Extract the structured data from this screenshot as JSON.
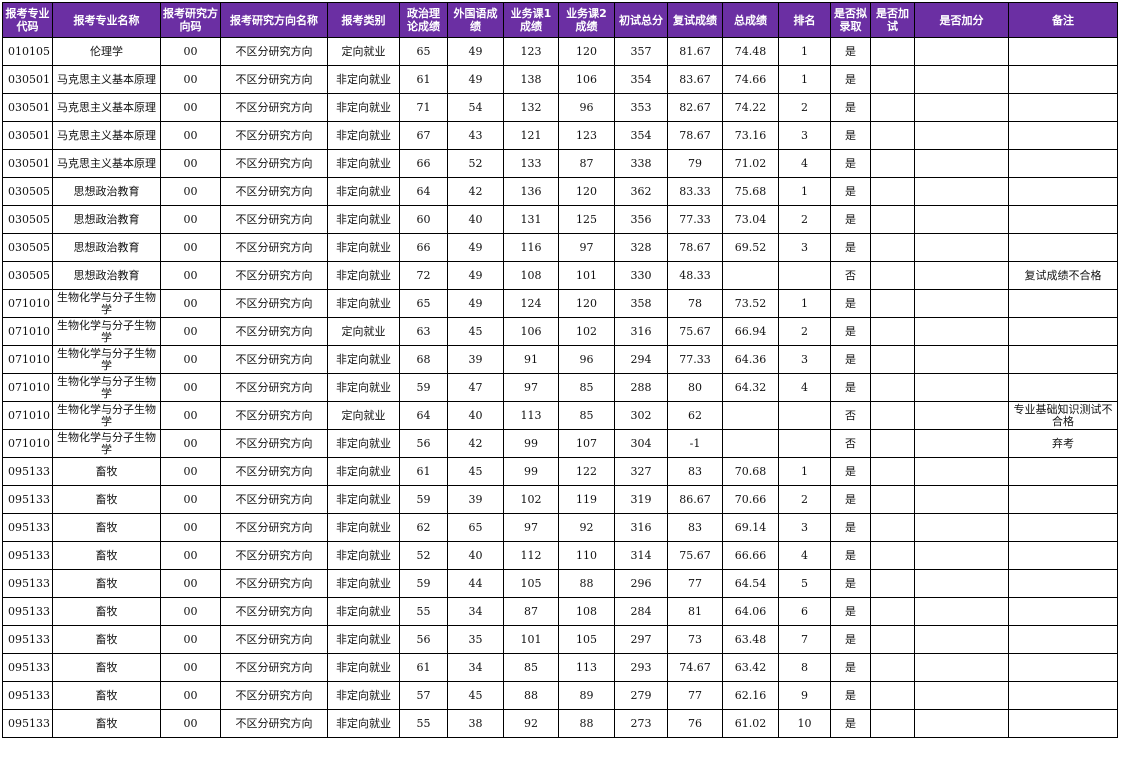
{
  "headers": [
    "报考专业代码",
    "报考专业名称",
    "报考研究方向码",
    "报考研究方向名称",
    "报考类别",
    "政治理论成绩",
    "外国语成绩",
    "业务课1成绩",
    "业务课2成绩",
    "初试总分",
    "复试成绩",
    "总成绩",
    "排名",
    "是否拟录取",
    "是否加试",
    "是否加分",
    "备注"
  ],
  "rows": [
    [
      "010105",
      "伦理学",
      "00",
      "不区分研究方向",
      "定向就业",
      "65",
      "49",
      "123",
      "120",
      "357",
      "81.67",
      "74.48",
      "1",
      "是",
      "",
      "",
      ""
    ],
    [
      "030501",
      "马克思主义基本原理",
      "00",
      "不区分研究方向",
      "非定向就业",
      "61",
      "49",
      "138",
      "106",
      "354",
      "83.67",
      "74.66",
      "1",
      "是",
      "",
      "",
      ""
    ],
    [
      "030501",
      "马克思主义基本原理",
      "00",
      "不区分研究方向",
      "非定向就业",
      "71",
      "54",
      "132",
      "96",
      "353",
      "82.67",
      "74.22",
      "2",
      "是",
      "",
      "",
      ""
    ],
    [
      "030501",
      "马克思主义基本原理",
      "00",
      "不区分研究方向",
      "非定向就业",
      "67",
      "43",
      "121",
      "123",
      "354",
      "78.67",
      "73.16",
      "3",
      "是",
      "",
      "",
      ""
    ],
    [
      "030501",
      "马克思主义基本原理",
      "00",
      "不区分研究方向",
      "非定向就业",
      "66",
      "52",
      "133",
      "87",
      "338",
      "79",
      "71.02",
      "4",
      "是",
      "",
      "",
      ""
    ],
    [
      "030505",
      "思想政治教育",
      "00",
      "不区分研究方向",
      "非定向就业",
      "64",
      "42",
      "136",
      "120",
      "362",
      "83.33",
      "75.68",
      "1",
      "是",
      "",
      "",
      ""
    ],
    [
      "030505",
      "思想政治教育",
      "00",
      "不区分研究方向",
      "非定向就业",
      "60",
      "40",
      "131",
      "125",
      "356",
      "77.33",
      "73.04",
      "2",
      "是",
      "",
      "",
      ""
    ],
    [
      "030505",
      "思想政治教育",
      "00",
      "不区分研究方向",
      "非定向就业",
      "66",
      "49",
      "116",
      "97",
      "328",
      "78.67",
      "69.52",
      "3",
      "是",
      "",
      "",
      ""
    ],
    [
      "030505",
      "思想政治教育",
      "00",
      "不区分研究方向",
      "非定向就业",
      "72",
      "49",
      "108",
      "101",
      "330",
      "48.33",
      "",
      "",
      "否",
      "",
      "",
      "复试成绩不合格"
    ],
    [
      "071010",
      "生物化学与分子生物学",
      "00",
      "不区分研究方向",
      "非定向就业",
      "65",
      "49",
      "124",
      "120",
      "358",
      "78",
      "73.52",
      "1",
      "是",
      "",
      "",
      ""
    ],
    [
      "071010",
      "生物化学与分子生物学",
      "00",
      "不区分研究方向",
      "定向就业",
      "63",
      "45",
      "106",
      "102",
      "316",
      "75.67",
      "66.94",
      "2",
      "是",
      "",
      "",
      ""
    ],
    [
      "071010",
      "生物化学与分子生物学",
      "00",
      "不区分研究方向",
      "非定向就业",
      "68",
      "39",
      "91",
      "96",
      "294",
      "77.33",
      "64.36",
      "3",
      "是",
      "",
      "",
      ""
    ],
    [
      "071010",
      "生物化学与分子生物学",
      "00",
      "不区分研究方向",
      "非定向就业",
      "59",
      "47",
      "97",
      "85",
      "288",
      "80",
      "64.32",
      "4",
      "是",
      "",
      "",
      ""
    ],
    [
      "071010",
      "生物化学与分子生物学",
      "00",
      "不区分研究方向",
      "定向就业",
      "64",
      "40",
      "113",
      "85",
      "302",
      "62",
      "",
      "",
      "否",
      "",
      "",
      "专业基础知识测试不合格"
    ],
    [
      "071010",
      "生物化学与分子生物学",
      "00",
      "不区分研究方向",
      "非定向就业",
      "56",
      "42",
      "99",
      "107",
      "304",
      "-1",
      "",
      "",
      "否",
      "",
      "",
      "弃考"
    ],
    [
      "095133",
      "畜牧",
      "00",
      "不区分研究方向",
      "非定向就业",
      "61",
      "45",
      "99",
      "122",
      "327",
      "83",
      "70.68",
      "1",
      "是",
      "",
      "",
      ""
    ],
    [
      "095133",
      "畜牧",
      "00",
      "不区分研究方向",
      "非定向就业",
      "59",
      "39",
      "102",
      "119",
      "319",
      "86.67",
      "70.66",
      "2",
      "是",
      "",
      "",
      ""
    ],
    [
      "095133",
      "畜牧",
      "00",
      "不区分研究方向",
      "非定向就业",
      "62",
      "65",
      "97",
      "92",
      "316",
      "83",
      "69.14",
      "3",
      "是",
      "",
      "",
      ""
    ],
    [
      "095133",
      "畜牧",
      "00",
      "不区分研究方向",
      "非定向就业",
      "52",
      "40",
      "112",
      "110",
      "314",
      "75.67",
      "66.66",
      "4",
      "是",
      "",
      "",
      ""
    ],
    [
      "095133",
      "畜牧",
      "00",
      "不区分研究方向",
      "非定向就业",
      "59",
      "44",
      "105",
      "88",
      "296",
      "77",
      "64.54",
      "5",
      "是",
      "",
      "",
      ""
    ],
    [
      "095133",
      "畜牧",
      "00",
      "不区分研究方向",
      "非定向就业",
      "55",
      "34",
      "87",
      "108",
      "284",
      "81",
      "64.06",
      "6",
      "是",
      "",
      "",
      ""
    ],
    [
      "095133",
      "畜牧",
      "00",
      "不区分研究方向",
      "非定向就业",
      "56",
      "35",
      "101",
      "105",
      "297",
      "73",
      "63.48",
      "7",
      "是",
      "",
      "",
      ""
    ],
    [
      "095133",
      "畜牧",
      "00",
      "不区分研究方向",
      "非定向就业",
      "61",
      "34",
      "85",
      "113",
      "293",
      "74.67",
      "63.42",
      "8",
      "是",
      "",
      "",
      ""
    ],
    [
      "095133",
      "畜牧",
      "00",
      "不区分研究方向",
      "非定向就业",
      "57",
      "45",
      "88",
      "89",
      "279",
      "77",
      "62.16",
      "9",
      "是",
      "",
      "",
      ""
    ],
    [
      "095133",
      "畜牧",
      "00",
      "不区分研究方向",
      "非定向就业",
      "55",
      "38",
      "92",
      "88",
      "273",
      "76",
      "61.02",
      "10",
      "是",
      "",
      "",
      ""
    ]
  ]
}
